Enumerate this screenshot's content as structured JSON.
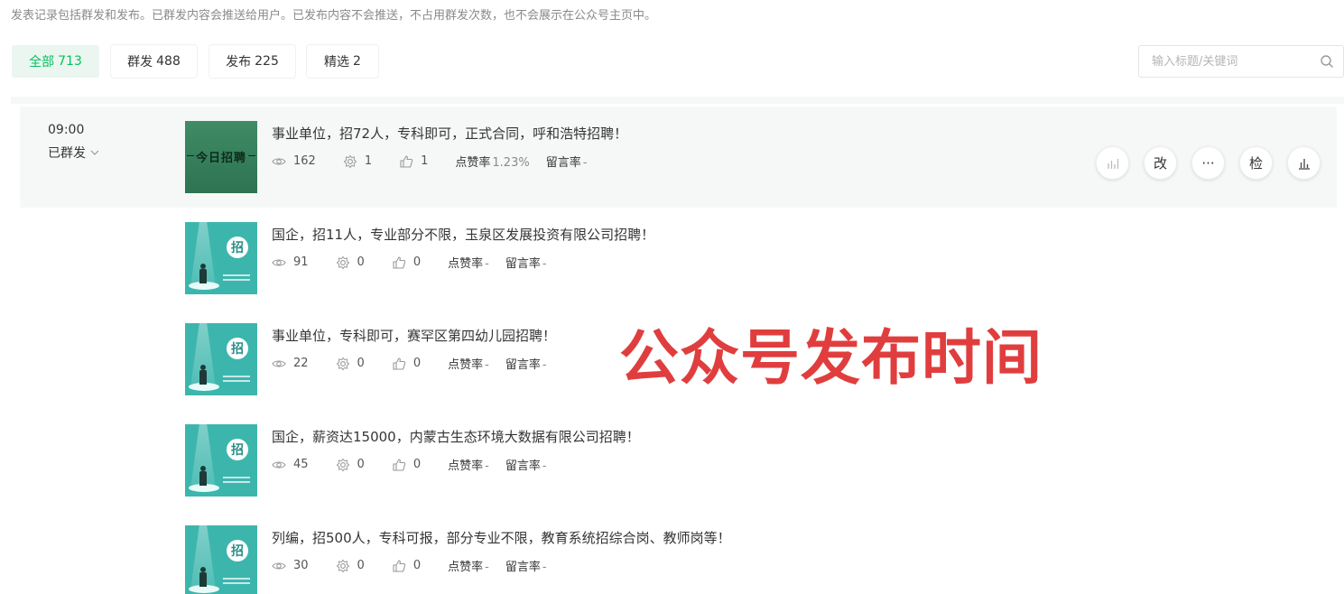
{
  "notice": "发表记录包括群发和发布。已群发内容会推送给用户。已发布内容不会推送，不占用群发次数，也不会展示在公众号主页中。",
  "tabs": [
    {
      "label": "全部",
      "count": "713",
      "active": true
    },
    {
      "label": "群发",
      "count": "488",
      "active": false
    },
    {
      "label": "发布",
      "count": "225",
      "active": false
    },
    {
      "label": "精选",
      "count": "2",
      "active": false
    }
  ],
  "search": {
    "placeholder": "输入标题/关键词",
    "value": ""
  },
  "group": {
    "time": "09:00",
    "status": "已群发"
  },
  "rate_labels": {
    "like_rate": "点赞率",
    "comment_rate": "留言率"
  },
  "articles": [
    {
      "title": "事业单位，招72人，专科即可，正式合同，呼和浩特招聘！",
      "cover_text": "今日招聘",
      "views": "162",
      "shares": "1",
      "likes": "1",
      "like_rate": "1.23%",
      "comment_rate": "-"
    },
    {
      "title": "国企，招11人，专业部分不限，玉泉区发展投资有限公司招聘！",
      "cover_text": "招",
      "views": "91",
      "shares": "0",
      "likes": "0",
      "like_rate": "-",
      "comment_rate": "-"
    },
    {
      "title": "事业单位，专科即可，赛罕区第四幼儿园招聘！",
      "cover_text": "招",
      "views": "22",
      "shares": "0",
      "likes": "0",
      "like_rate": "-",
      "comment_rate": "-"
    },
    {
      "title": "国企，薪资达15000，内蒙古生态环境大数据有限公司招聘！",
      "cover_text": "招",
      "views": "45",
      "shares": "0",
      "likes": "0",
      "like_rate": "-",
      "comment_rate": "-"
    },
    {
      "title": "列编，招500人，专科可报，部分专业不限，教育系统招综合岗、教师岗等！",
      "cover_text": "招",
      "views": "30",
      "shares": "0",
      "likes": "0",
      "like_rate": "-",
      "comment_rate": "-"
    }
  ],
  "actions": [
    {
      "label": "",
      "icon": "bar-chart-icon"
    },
    {
      "label": "改",
      "icon": ""
    },
    {
      "label": "···",
      "icon": ""
    },
    {
      "label": "检",
      "icon": ""
    },
    {
      "label": "",
      "icon": "stats-icon"
    }
  ],
  "overlay_caption": "公众号发布时间",
  "colors": {
    "accent": "#07c160",
    "caption": "#e03e3e",
    "cover_teal": "#3cb6ad",
    "cover_green": "#3f8c65"
  }
}
